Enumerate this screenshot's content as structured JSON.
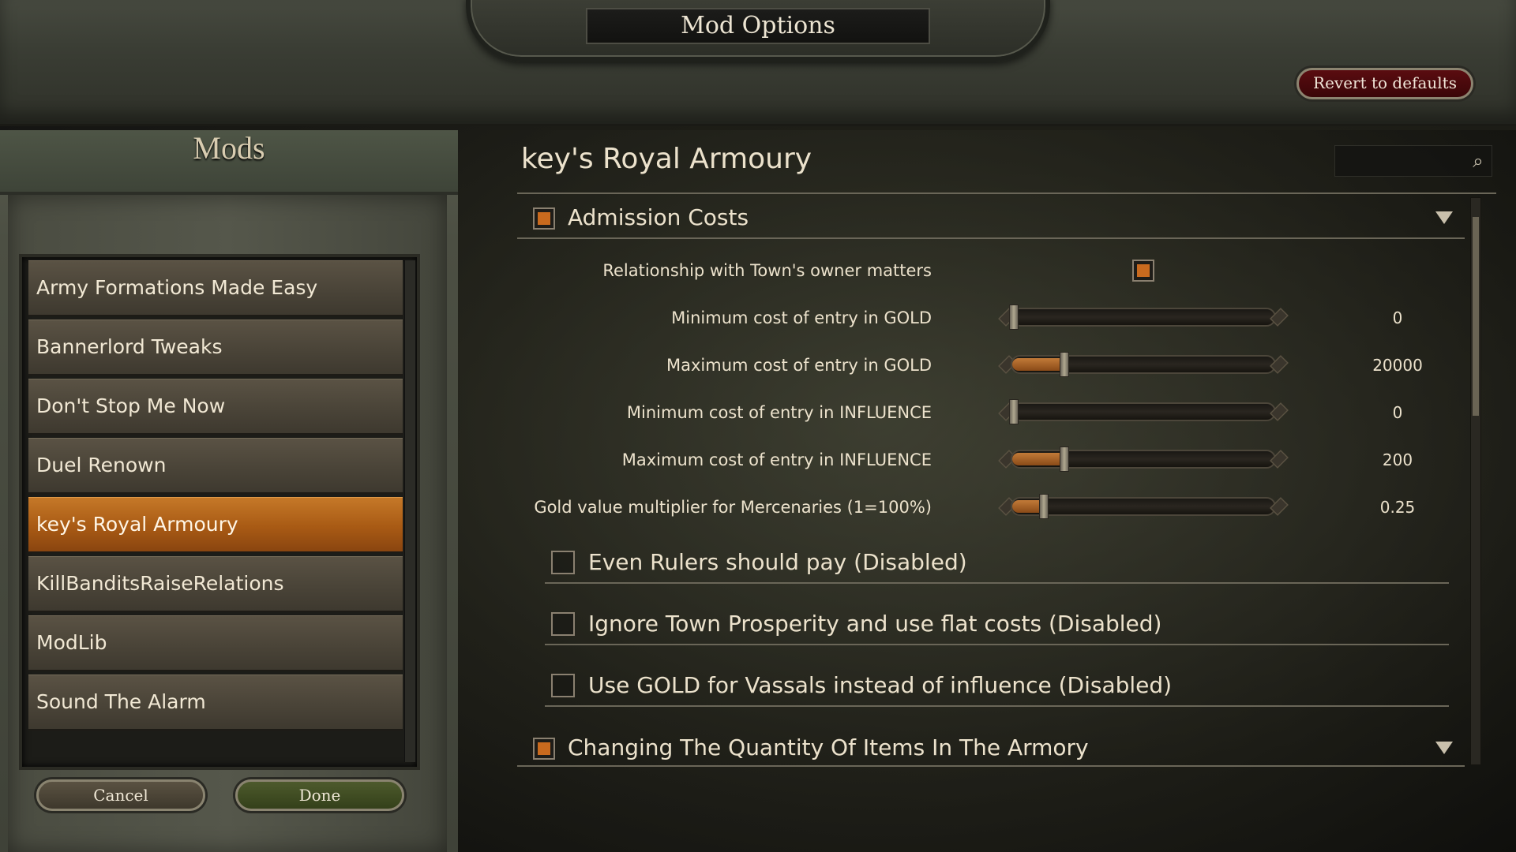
{
  "window": {
    "title": "Mod Options",
    "revert_label": "Revert to defaults"
  },
  "sidebar": {
    "title": "Mods",
    "items": [
      {
        "label": "Army Formations Made Easy",
        "selected": false
      },
      {
        "label": "Bannerlord Tweaks",
        "selected": false
      },
      {
        "label": "Don't Stop Me Now",
        "selected": false
      },
      {
        "label": "Duel Renown",
        "selected": false
      },
      {
        "label": "key's Royal Armoury",
        "selected": true
      },
      {
        "label": "KillBanditsRaiseRelations",
        "selected": false
      },
      {
        "label": "ModLib",
        "selected": false
      },
      {
        "label": "Sound The Alarm",
        "selected": false
      }
    ],
    "cancel_label": "Cancel",
    "done_label": "Done"
  },
  "main": {
    "mod_title": "key's Royal Armoury",
    "search": {
      "value": "",
      "icon": "search-icon"
    },
    "groups": [
      {
        "label": "Admission Costs",
        "enabled": true,
        "expanded": true,
        "settings": [
          {
            "label": "Relationship with Town's owner matters",
            "type": "checkbox",
            "checked": true
          },
          {
            "label": "Minimum cost of entry in GOLD",
            "type": "slider",
            "value": "0",
            "fill": 0.0
          },
          {
            "label": "Maximum cost of entry in GOLD",
            "type": "slider",
            "value": "20000",
            "fill": 0.2
          },
          {
            "label": "Minimum cost of entry in INFLUENCE",
            "type": "slider",
            "value": "0",
            "fill": 0.0
          },
          {
            "label": "Maximum cost of entry in INFLUENCE",
            "type": "slider",
            "value": "200",
            "fill": 0.2
          },
          {
            "label": "Gold value multiplier for Mercenaries (1=100%)",
            "type": "slider",
            "value": "0.25",
            "fill": 0.12
          }
        ]
      },
      {
        "label": "Even Rulers should pay (Disabled)",
        "enabled": false
      },
      {
        "label": "Ignore Town Prosperity and use flat costs (Disabled)",
        "enabled": false
      },
      {
        "label": "Use GOLD for Vassals instead of influence (Disabled)",
        "enabled": false
      },
      {
        "label": "Changing The Quantity Of Items In The Armory",
        "enabled": true,
        "expanded": false
      }
    ]
  },
  "colors": {
    "accent": "#c96a1e",
    "selected_item": "#b0621a",
    "revert_button": "#4a0a0d"
  }
}
